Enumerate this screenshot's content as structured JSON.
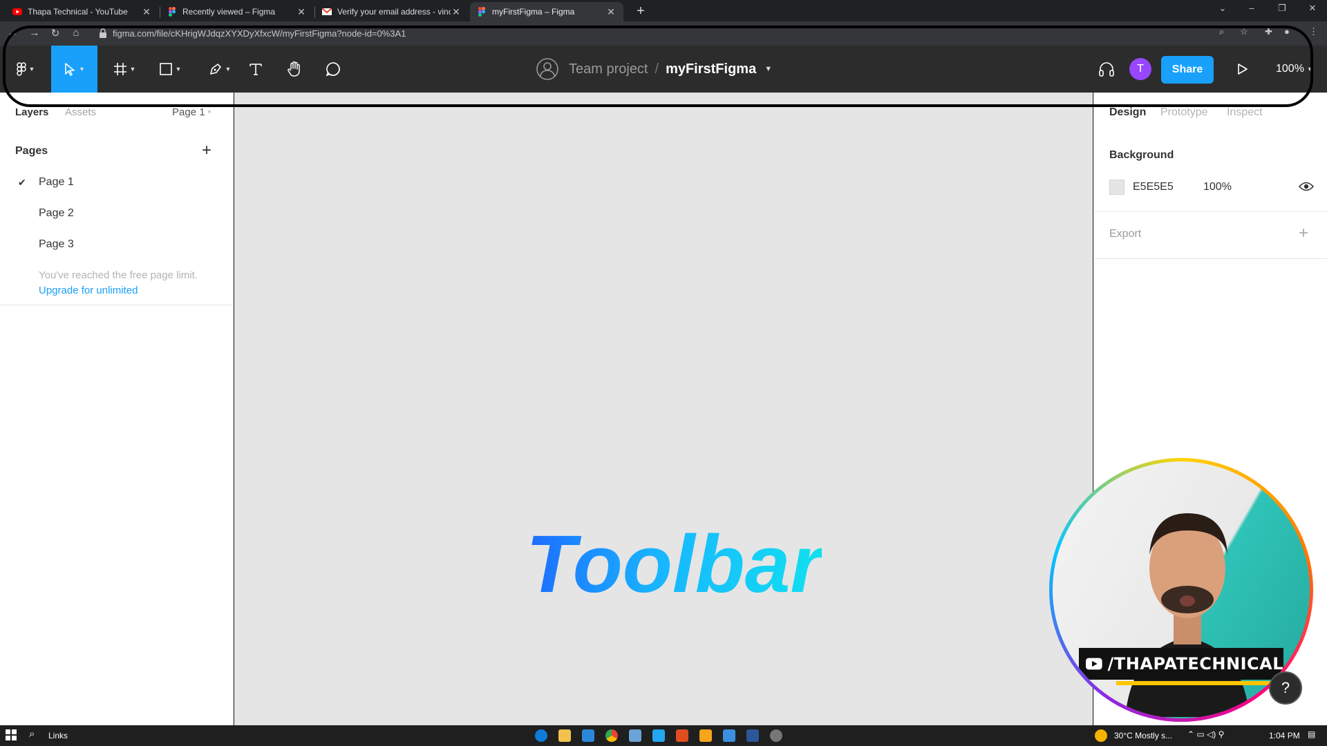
{
  "browser": {
    "tabs": [
      {
        "title": "Thapa Technical - YouTube",
        "favicon": "youtube-icon",
        "active": false
      },
      {
        "title": "Recently viewed – Figma",
        "favicon": "figma-icon",
        "active": false
      },
      {
        "title": "Verify your email address - vinod",
        "favicon": "gmail-icon",
        "active": false
      },
      {
        "title": "myFirstFigma – Figma",
        "favicon": "figma-icon",
        "active": true
      }
    ],
    "url": "figma.com/file/cKHrigWJdqzXYXDyXfxcW/myFirstFigma?node-id=0%3A1"
  },
  "figma_toolbar": {
    "team": "Team project",
    "separator": "/",
    "file_name": "myFirstFigma",
    "share_label": "Share",
    "avatar_initial": "T",
    "zoom": "100%"
  },
  "left_panel": {
    "tabs": [
      "Layers",
      "Assets"
    ],
    "current_page": "Page 1",
    "pages_heading": "Pages",
    "pages": [
      "Page 1",
      "Page 2",
      "Page 3"
    ],
    "limit_note": "You've reached the free page limit.",
    "upgrade_link": "Upgrade for unlimited"
  },
  "canvas": {
    "title": "Toolbar",
    "background": "#E5E5E5"
  },
  "right_panel": {
    "tabs": [
      "Design",
      "Prototype",
      "Inspect"
    ],
    "background_heading": "Background",
    "bg_hex": "E5E5E5",
    "bg_opacity": "100%",
    "export_heading": "Export"
  },
  "webcam": {
    "channel": "/THAPATECHNICAL"
  },
  "taskbar": {
    "search_label": "Links",
    "weather": "30°C  Mostly s...",
    "time": "1:04 PM"
  },
  "colors": {
    "accent": "#18a0fb",
    "toolbar_bg": "#2c2c2c"
  }
}
